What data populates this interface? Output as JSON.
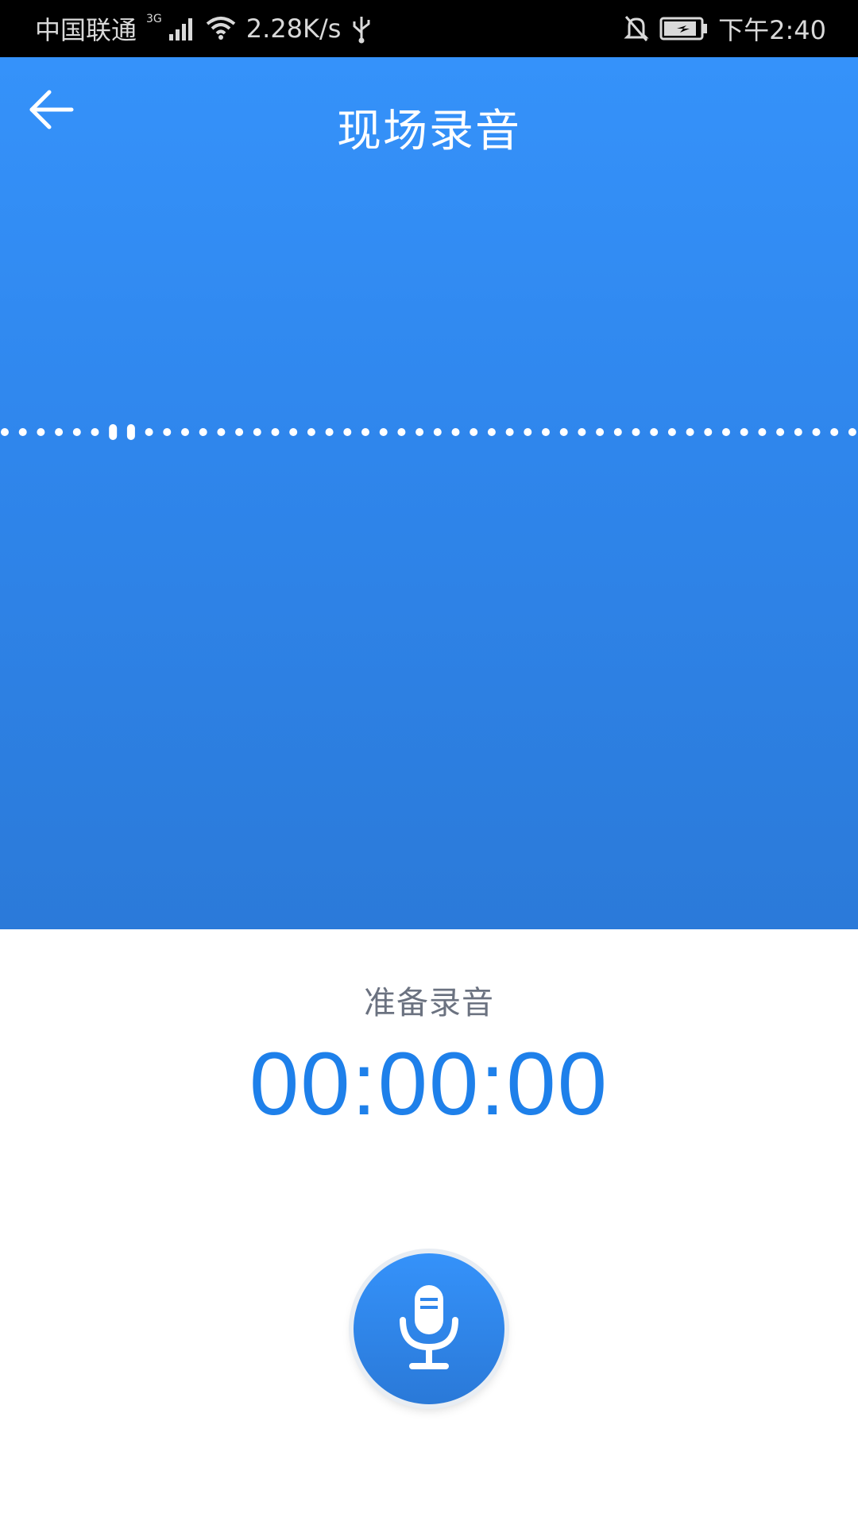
{
  "status_bar": {
    "carrier": "中国联通",
    "network_type": "3G",
    "speed": "2.28K/s",
    "time": "下午2:40",
    "icons": [
      "signal-icon",
      "wifi-icon",
      "usb-icon",
      "notifications-off-icon",
      "battery-icon"
    ]
  },
  "header": {
    "title": "现场录音",
    "back_icon": "back-arrow-icon"
  },
  "recorder": {
    "status": "准备录音",
    "timer": "00:00:00",
    "record_button_icon": "microphone-icon"
  },
  "colors": {
    "primary": "#3592fa",
    "primary_dark": "#2b7ad9",
    "timer": "#1e80ea",
    "status_text": "#6b7280"
  }
}
